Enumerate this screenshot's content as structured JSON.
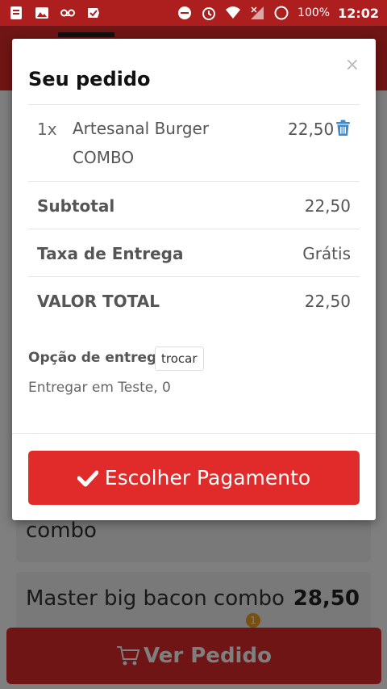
{
  "status_bar": {
    "battery": "100%",
    "time": "12:02",
    "left_icons": [
      "notes-icon",
      "image-icon",
      "voicemail-icon",
      "check-icon"
    ],
    "right_icons": [
      "dnd-icon",
      "alarm-icon",
      "wifi-icon",
      "signal-icon",
      "battery-icon"
    ]
  },
  "background": {
    "items": [
      {
        "name": "combo",
        "price": ""
      },
      {
        "name": "Master big bacon combo",
        "price": "28,50"
      }
    ],
    "bottom_button": {
      "label": "Ver Pedido",
      "badge": "1"
    }
  },
  "modal": {
    "title": "Seu pedido",
    "close": "×",
    "order_items": [
      {
        "qty": "1x",
        "name": "Artesanal Burger COMBO",
        "price": "22,50"
      }
    ],
    "summary": [
      {
        "label": "Subtotal",
        "value": "22,50"
      },
      {
        "label": "Taxa de Entrega",
        "value": "Grátis"
      },
      {
        "label": "VALOR TOTAL",
        "value": "22,50"
      }
    ],
    "delivery": {
      "label": "Opção de entrega",
      "change_button": "trocar",
      "address": "Entregar em Teste, 0"
    },
    "pay_button": "Escolher Pagamento"
  },
  "colors": {
    "brand_red": "#e12a2a",
    "status_red": "#ad1e1e",
    "trash_blue": "#3b8bd1"
  }
}
